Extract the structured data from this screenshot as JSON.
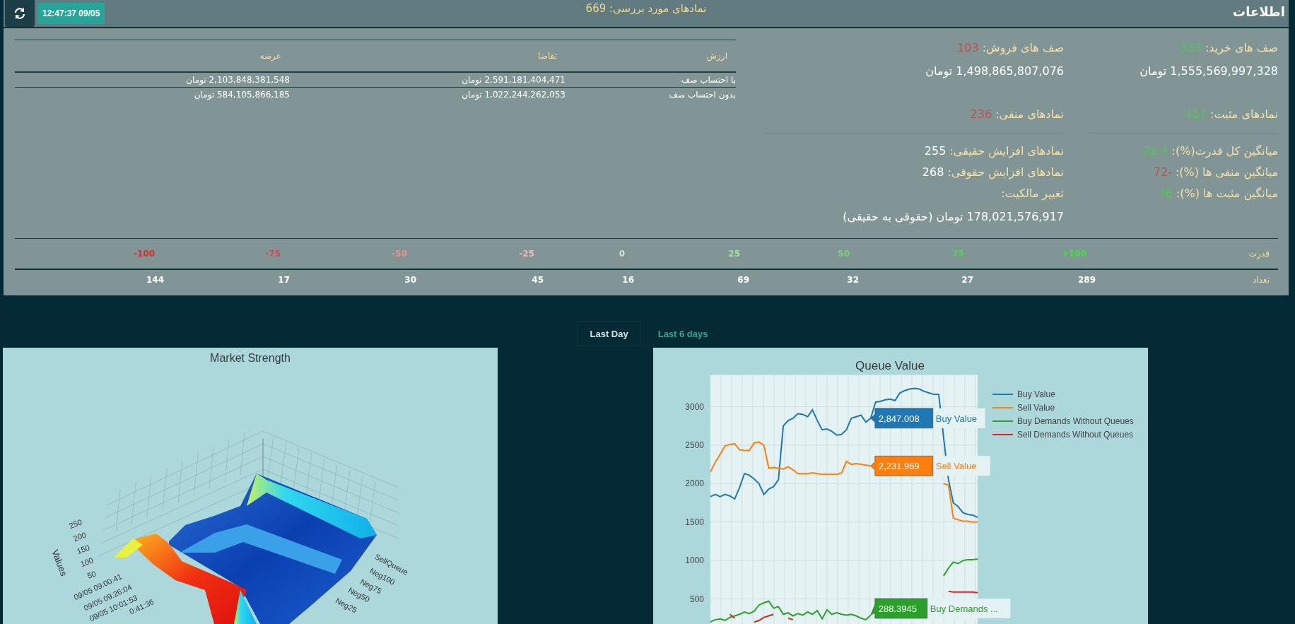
{
  "header": {
    "title": "اطلاعات",
    "symbols_reviewed": "نمادهای مورد بررسی: 669",
    "timestamp": "12:47:37 09/05"
  },
  "value_table": {
    "columns": [
      "ارزش",
      "تقاضا",
      "عرضه"
    ],
    "rows": [
      [
        "با احتساب صف",
        "2,591,181,404,471 تومان",
        "2,103,848,381,548 تومان"
      ],
      [
        "بدون احتساب صف",
        "1,022,244,262,053 تومان",
        "584,105,866,185 تومان"
      ]
    ]
  },
  "stats": [
    {
      "rows": [
        {
          "kind": "stat",
          "label": "صف های خرید:",
          "value": "333",
          "color": "#4cc94c"
        },
        {
          "kind": "amount",
          "text": "1,555,569,997,328 تومان"
        },
        {
          "kind": "gap"
        },
        {
          "kind": "stat",
          "label": "نمادهای مثبت:",
          "value": "417",
          "color": "#4cc94c"
        },
        {
          "kind": "divider"
        },
        {
          "kind": "stat",
          "label": "میانگین کل قدرت(%):",
          "value": "22.4",
          "color": "#4cc94c"
        },
        {
          "kind": "stat",
          "label": "میانگین منفی ها (%):",
          "value": "-72",
          "color": "#c0504d"
        },
        {
          "kind": "stat",
          "label": "میانگین مثبت ها (%):",
          "value": "76",
          "color": "#4cc94c"
        }
      ]
    },
    {
      "rows": [
        {
          "kind": "stat",
          "label": "صف های فروش:",
          "value": "103",
          "color": "#c0504d"
        },
        {
          "kind": "amount",
          "text": "1,498,865,807,076 تومان"
        },
        {
          "kind": "gap"
        },
        {
          "kind": "stat",
          "label": "نمادهای منفی:",
          "value": "236",
          "color": "#c0504d"
        },
        {
          "kind": "divider"
        },
        {
          "kind": "stat",
          "label": "نمادهای افزایش حقیقی:",
          "value": "255"
        },
        {
          "kind": "stat",
          "label": "نمادهای افزایش حقوقی:",
          "value": "268"
        },
        {
          "kind": "stat",
          "label": "تغییر مالکیت:"
        },
        {
          "kind": "amount",
          "text": "178,021,576,917 تومان (حقوقی به حقیقی)"
        }
      ]
    }
  ],
  "strength": {
    "label": "قدرت",
    "count_label": "تعداد",
    "tiers": [
      {
        "tier": "+100",
        "count": "289",
        "color": "#3ee03e"
      },
      {
        "tier": "75",
        "count": "27",
        "color": "#55d055"
      },
      {
        "tier": "50",
        "count": "32",
        "color": "#78d078"
      },
      {
        "tier": "25",
        "count": "69",
        "color": "#a0e0a0"
      },
      {
        "tier": "0",
        "count": "16",
        "color": "#d8dedc"
      },
      {
        "tier": "-25",
        "count": "45",
        "color": "#f0b8b8"
      },
      {
        "tier": "-50",
        "count": "30",
        "color": "#e89090"
      },
      {
        "tier": "-75",
        "count": "17",
        "color": "#d24c4c"
      },
      {
        "tier": "-100",
        "count": "144",
        "color": "#e02828"
      }
    ]
  },
  "tabs": [
    {
      "label": "Last 6 days",
      "selected": false
    },
    {
      "label": "Last Day",
      "selected": true
    }
  ],
  "market_strength": {
    "title": "Market Strength",
    "z_axis_title": "Values",
    "z_ticks": [
      "250",
      "200",
      "150",
      "100",
      "50"
    ],
    "time_ticks": [
      "09/05 09:00:41",
      "09/05 09:26:04",
      "09/05 10:01:53",
      "0:41:36"
    ],
    "category_ticks": [
      "SellQueue",
      "Neg100",
      "Neg75",
      "Neg50",
      "Neg25"
    ]
  },
  "queue_value": {
    "chart_data": {
      "type": "line",
      "title": "Queue Value",
      "ylim": [
        174,
        3414
      ],
      "yticks": [
        500,
        1000,
        1500,
        2000,
        2500,
        3000
      ],
      "grid": true,
      "legend": true,
      "series": [
        {
          "name": "Buy Value",
          "color": "#1f77b4",
          "values": [
            1830,
            1860,
            1830,
            1860,
            1840,
            1800,
            1950,
            2130,
            2110,
            2060,
            2000,
            1860,
            1930,
            1960,
            2050,
            2750,
            2820,
            2850,
            2910,
            2900,
            2870,
            2960,
            2820,
            2700,
            2710,
            2680,
            2630,
            2640,
            2700,
            2850,
            2870,
            2890,
            2800,
            2850,
            3060,
            3070,
            3090,
            3100,
            3080,
            3180,
            3210,
            3230,
            3240,
            3230,
            3200,
            3180,
            3160,
            3160,
            2600,
            2050,
            1750,
            1700,
            1620,
            1600,
            1590,
            1560
          ]
        },
        {
          "name": "Sell Value",
          "color": "#ff7f0e",
          "values": [
            2150,
            2280,
            2380,
            2490,
            2510,
            2520,
            2440,
            2430,
            2430,
            2530,
            2540,
            2500,
            2200,
            2210,
            2200,
            2190,
            2220,
            2180,
            2130,
            2130,
            2130,
            2140,
            2130,
            2120,
            2120,
            2120,
            2120,
            2140,
            2290,
            2250,
            2260,
            2250,
            2240,
            2230,
            null,
            null,
            null,
            null,
            null,
            null,
            null,
            null,
            null,
            null,
            null,
            null,
            null,
            null,
            2000,
            1980,
            1550,
            1530,
            1510,
            1510,
            1500,
            1500
          ]
        },
        {
          "name": "Buy Demands Without Queues",
          "color": "#2ca02c",
          "values": [
            200,
            230,
            240,
            220,
            260,
            280,
            300,
            330,
            310,
            340,
            420,
            450,
            470,
            380,
            400,
            300,
            320,
            280,
            310,
            290,
            330,
            300,
            350,
            240,
            360,
            300,
            320,
            300,
            290,
            300,
            280,
            250,
            230,
            290,
            null,
            null,
            null,
            null,
            null,
            null,
            null,
            null,
            null,
            null,
            null,
            null,
            null,
            null,
            800,
            900,
            980,
            960,
            1000,
            1010,
            1010,
            1020
          ]
        },
        {
          "name": "Sell Demands Without Queues",
          "color": "#d62728",
          "values": [
            null,
            null,
            null,
            null,
            300,
            250,
            null,
            null,
            null,
            200,
            220,
            260,
            280,
            300,
            null,
            null,
            250,
            230,
            null,
            null,
            null,
            null,
            null,
            null,
            null,
            null,
            null,
            null,
            null,
            null,
            null,
            null,
            null,
            null,
            null,
            null,
            null,
            null,
            null,
            null,
            null,
            null,
            null,
            null,
            null,
            null,
            null,
            null,
            null,
            600,
            590,
            590,
            590,
            590,
            590,
            580
          ]
        }
      ]
    },
    "hover_labels": [
      {
        "value": "2,847.008",
        "name": "Buy Value"
      },
      {
        "value": "2,231.969",
        "name": "Sell Value"
      },
      {
        "value": "288.3945",
        "name": "Buy Demands ..."
      }
    ]
  }
}
